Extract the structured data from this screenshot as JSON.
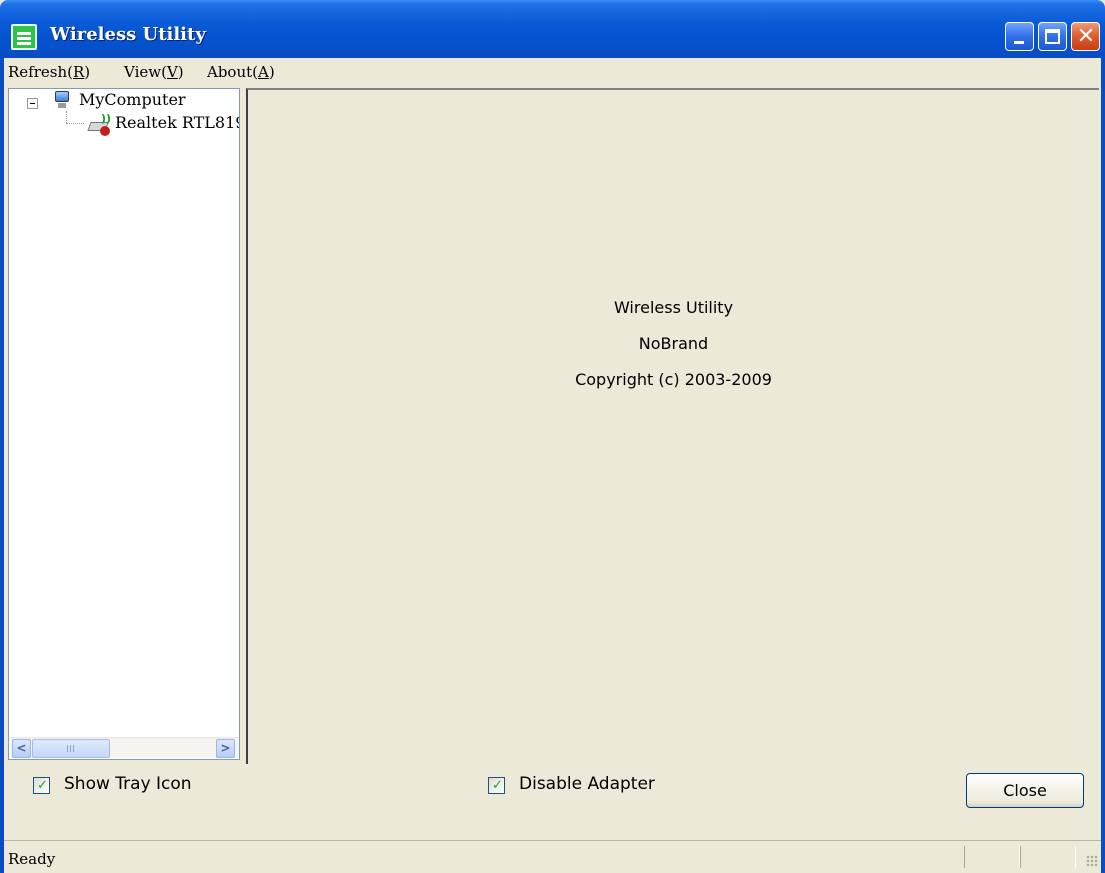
{
  "window": {
    "title": "Wireless Utility",
    "app_icon": "app-icon",
    "controls": [
      "minimize-icon",
      "maximize-icon",
      "close-icon"
    ],
    "close_glyph": "✕"
  },
  "menu": {
    "refresh": {
      "label": "Refresh(",
      "key": "R",
      "suffix": ")"
    },
    "view": {
      "label": "View(",
      "key": "V",
      "suffix": ")"
    },
    "about": {
      "label": "About(",
      "key": "A",
      "suffix": ")"
    }
  },
  "tree": {
    "root_label": "MyComputer",
    "root_icon": "computer-icon",
    "child_label": "Realtek RTL819",
    "child_icon": "wireless-adapter-icon"
  },
  "about_panel": {
    "line1": "Wireless Utility",
    "line2": "NoBrand",
    "line3": "Copyright (c) 2003-2009"
  },
  "options": {
    "show_tray_icon": {
      "label": "Show Tray Icon",
      "checked": true
    },
    "disable_adapter": {
      "label": "Disable Adapter",
      "checked": true
    },
    "close_button": "Close"
  },
  "status": {
    "text": "Ready"
  },
  "colors": {
    "titlebar": "#0a5ad6",
    "window_bg": "#ece9d8",
    "close_button_red": "#e05a2b",
    "checkmark_green": "#21a121"
  }
}
